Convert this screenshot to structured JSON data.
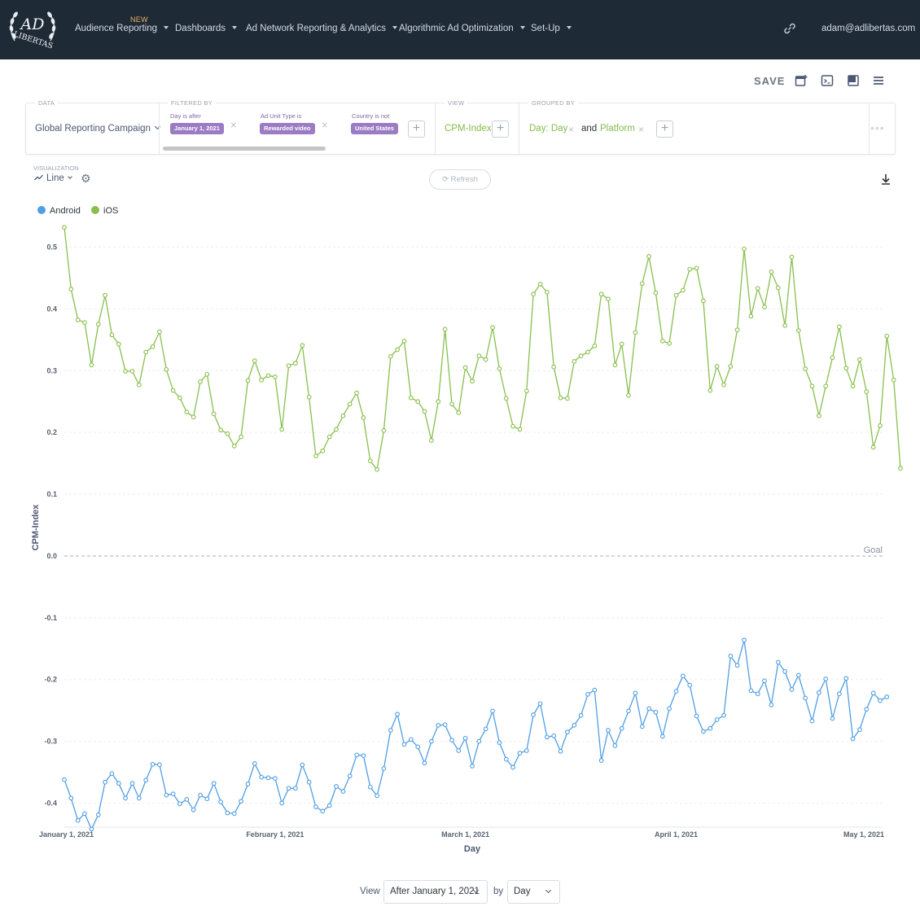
{
  "nav": {
    "logo_alt": "Ad Libertas",
    "new_badge": "NEW",
    "items": [
      {
        "label": "Audience Reporting"
      },
      {
        "label": "Dashboards"
      },
      {
        "label": "Ad Network Reporting & Analytics"
      },
      {
        "label": "Algorithmic Ad Optimization"
      },
      {
        "label": "Set-Up"
      }
    ],
    "user": "adam@adlibertas.com",
    "link_icon": "link-icon"
  },
  "toolbar": {
    "save_label": "SAVE",
    "icons": [
      "add-to-dashboard-icon",
      "embed-icon",
      "bookmark-icon",
      "menu-icon"
    ]
  },
  "query": {
    "data_label": "DATA",
    "data_source": "Global Reporting Campaign",
    "filtered_label": "FILTERED BY",
    "filters": [
      {
        "caption": "Day is after",
        "value": "January 1, 2021"
      },
      {
        "caption": "Ad Unit Type is",
        "value": "Rewarded video"
      },
      {
        "caption": "Country is not",
        "value": "United States"
      }
    ],
    "view_label": "VIEW",
    "view_metric": "CPM-Index",
    "grouped_label": "GROUPED BY",
    "group_1": "Day: Day",
    "group_and": "and",
    "group_2": "Platform",
    "add_symbol": "+",
    "remove_symbol": "×",
    "more_symbol": "•••"
  },
  "viz": {
    "label": "VISUALIZATION",
    "type": "Line",
    "refresh_label": "Refresh"
  },
  "footer": {
    "view_text": "View",
    "range_value": "After January 1, 2021",
    "by_text": "by",
    "unit_value": "Day"
  },
  "chart_data": {
    "type": "line",
    "xlabel": "Day",
    "ylabel": "CPM-Index",
    "ylim": [
      -0.44,
      0.54
    ],
    "yticks": [
      0.5,
      0.4,
      0.3,
      0.2,
      0.1,
      0.0,
      -0.1,
      -0.2,
      -0.3,
      -0.4
    ],
    "ytick_labels": [
      "0.5",
      "0.4",
      "0.3",
      "0.2",
      "0.1",
      "0.0",
      "-0.1",
      "-0.2",
      "-0.3",
      "-0.4"
    ],
    "xlim": [
      "2021-01-01",
      "2021-05-01"
    ],
    "xticks": [
      "2021-01-01",
      "2021-02-01",
      "2021-03-01",
      "2021-04-01",
      "2021-05-01"
    ],
    "xtick_labels": [
      "January 1, 2021",
      "February 1, 2021",
      "March 1, 2021",
      "April 1, 2021",
      "May 1, 2021"
    ],
    "grid": "horizontal",
    "legend_position": "top-left",
    "goal": {
      "value": 0.0,
      "label": "Goal"
    },
    "series": [
      {
        "name": "Android",
        "color": "#509ee3",
        "start_date": "2021-01-01",
        "values": [
          -0.362,
          -0.392,
          -0.428,
          -0.417,
          -0.442,
          -0.419,
          -0.366,
          -0.352,
          -0.368,
          -0.392,
          -0.368,
          -0.392,
          -0.363,
          -0.337,
          -0.338,
          -0.387,
          -0.385,
          -0.401,
          -0.394,
          -0.411,
          -0.387,
          -0.393,
          -0.368,
          -0.398,
          -0.416,
          -0.417,
          -0.397,
          -0.369,
          -0.336,
          -0.358,
          -0.359,
          -0.36,
          -0.4,
          -0.376,
          -0.376,
          -0.338,
          -0.366,
          -0.406,
          -0.413,
          -0.404,
          -0.373,
          -0.381,
          -0.356,
          -0.322,
          -0.323,
          -0.374,
          -0.388,
          -0.344,
          -0.282,
          -0.256,
          -0.305,
          -0.297,
          -0.309,
          -0.335,
          -0.3,
          -0.274,
          -0.273,
          -0.298,
          -0.315,
          -0.295,
          -0.34,
          -0.3,
          -0.28,
          -0.251,
          -0.302,
          -0.329,
          -0.342,
          -0.319,
          -0.315,
          -0.257,
          -0.239,
          -0.293,
          -0.291,
          -0.316,
          -0.285,
          -0.274,
          -0.258,
          -0.224,
          -0.217,
          -0.331,
          -0.282,
          -0.307,
          -0.279,
          -0.251,
          -0.222,
          -0.276,
          -0.247,
          -0.253,
          -0.292,
          -0.247,
          -0.219,
          -0.194,
          -0.209,
          -0.259,
          -0.284,
          -0.279,
          -0.265,
          -0.258,
          -0.162,
          -0.177,
          -0.136,
          -0.218,
          -0.223,
          -0.202,
          -0.241,
          -0.172,
          -0.187,
          -0.216,
          -0.193,
          -0.23,
          -0.267,
          -0.221,
          -0.199,
          -0.263,
          -0.223,
          -0.198,
          -0.296,
          -0.281,
          -0.248,
          -0.222,
          -0.234,
          -0.228
        ]
      },
      {
        "name": "iOS",
        "color": "#88bf4d",
        "start_date": "2021-01-01",
        "values": [
          0.532,
          0.432,
          0.382,
          0.378,
          0.309,
          0.375,
          0.422,
          0.358,
          0.343,
          0.299,
          0.299,
          0.277,
          0.33,
          0.339,
          0.363,
          0.302,
          0.268,
          0.256,
          0.233,
          0.225,
          0.282,
          0.294,
          0.23,
          0.204,
          0.198,
          0.178,
          0.193,
          0.284,
          0.316,
          0.285,
          0.292,
          0.29,
          0.205,
          0.308,
          0.312,
          0.341,
          0.257,
          0.162,
          0.17,
          0.193,
          0.205,
          0.227,
          0.246,
          0.264,
          0.224,
          0.154,
          0.14,
          0.203,
          0.323,
          0.334,
          0.348,
          0.256,
          0.25,
          0.234,
          0.187,
          0.25,
          0.367,
          0.246,
          0.232,
          0.305,
          0.283,
          0.324,
          0.318,
          0.37,
          0.303,
          0.255,
          0.21,
          0.205,
          0.267,
          0.424,
          0.44,
          0.427,
          0.306,
          0.256,
          0.255,
          0.315,
          0.324,
          0.33,
          0.34,
          0.424,
          0.416,
          0.309,
          0.343,
          0.26,
          0.362,
          0.441,
          0.485,
          0.426,
          0.348,
          0.344,
          0.422,
          0.43,
          0.464,
          0.466,
          0.413,
          0.268,
          0.307,
          0.277,
          0.307,
          0.366,
          0.497,
          0.388,
          0.433,
          0.403,
          0.46,
          0.434,
          0.373,
          0.484,
          0.365,
          0.303,
          0.275,
          0.227,
          0.275,
          0.321,
          0.371,
          0.304,
          0.275,
          0.318,
          0.266,
          0.176,
          0.211,
          0.356,
          0.285,
          0.142
        ]
      }
    ]
  }
}
